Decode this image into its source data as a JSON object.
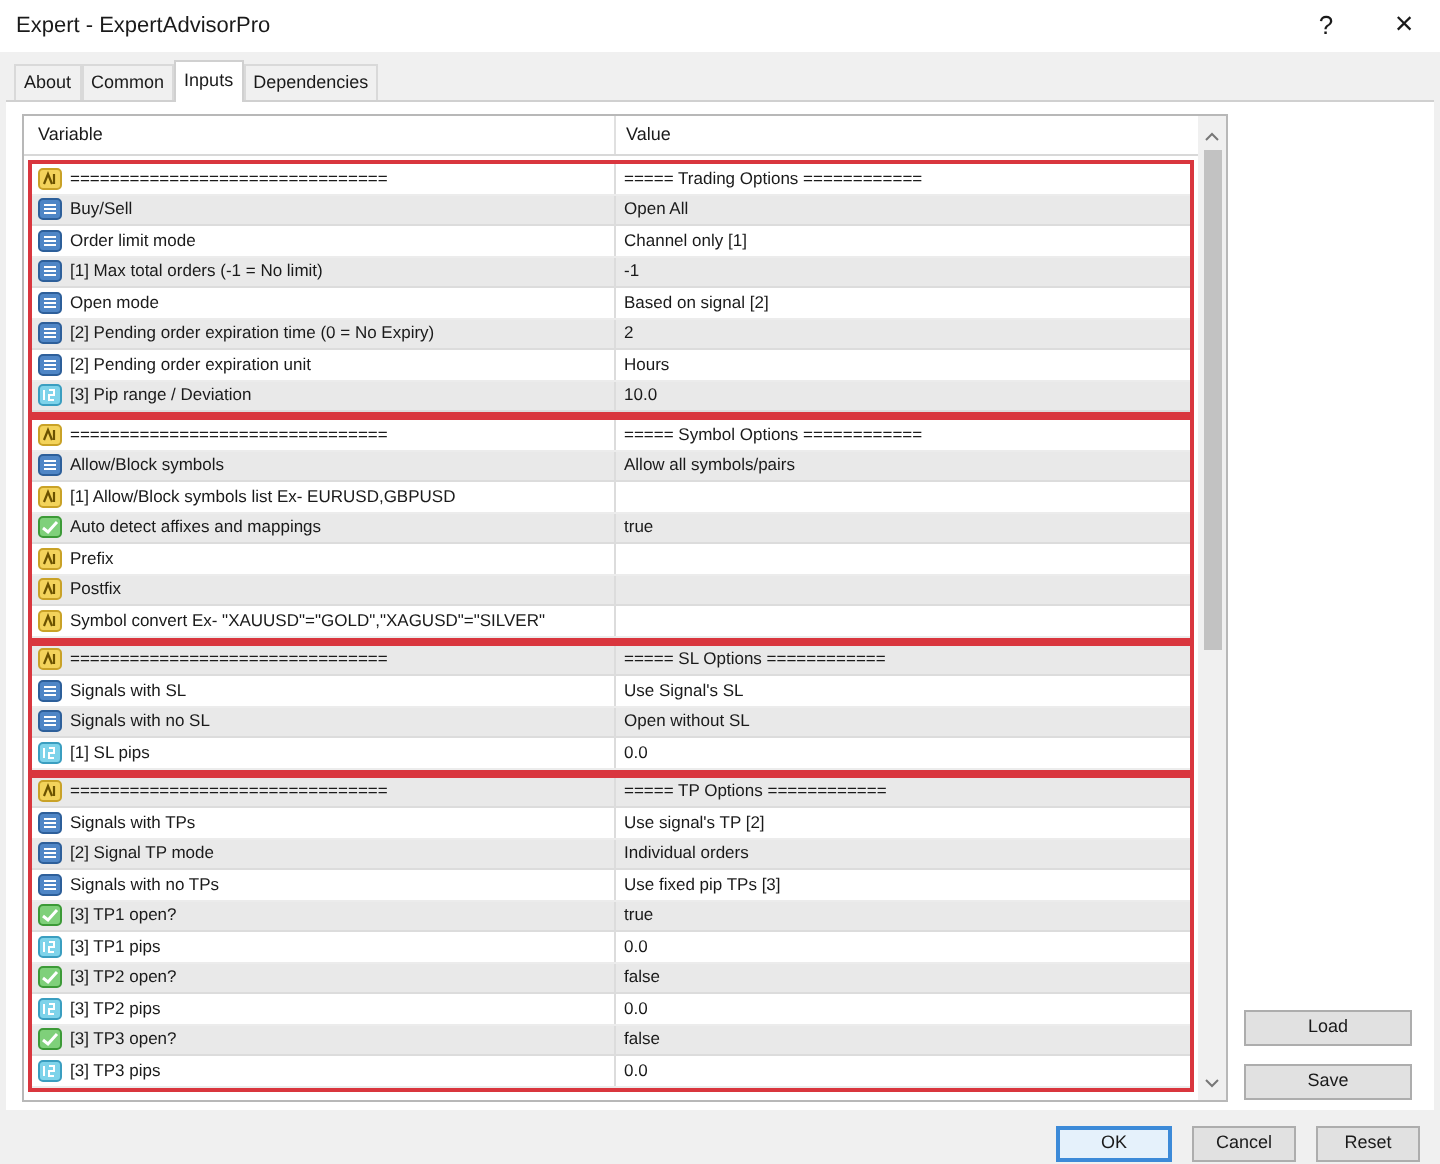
{
  "window": {
    "title": "Expert - ExpertAdvisorPro",
    "help": "?",
    "close": "×"
  },
  "tabs": [
    {
      "label": "About",
      "selected": false
    },
    {
      "label": "Common",
      "selected": false
    },
    {
      "label": "Inputs",
      "selected": true
    },
    {
      "label": "Dependencies",
      "selected": false
    }
  ],
  "table": {
    "columns": [
      "Variable",
      "Value"
    ],
    "groups": [
      {
        "rows": [
          {
            "kind": "string",
            "variable": "================================",
            "value": "===== Trading Options ============"
          },
          {
            "kind": "enum",
            "variable": "Buy/Sell",
            "value": "Open All"
          },
          {
            "kind": "enum",
            "variable": "Order limit mode",
            "value": "Channel only [1]"
          },
          {
            "kind": "enum",
            "variable": "[1] Max total orders (-1 = No limit)",
            "value": "-1"
          },
          {
            "kind": "enum",
            "variable": "Open mode",
            "value": "Based on signal [2]"
          },
          {
            "kind": "enum",
            "variable": "[2] Pending order expiration time (0 = No Expiry)",
            "value": "2"
          },
          {
            "kind": "enum",
            "variable": "[2] Pending order expiration unit",
            "value": "Hours"
          },
          {
            "kind": "number",
            "variable": "[3] Pip range / Deviation",
            "value": "10.0"
          }
        ]
      },
      {
        "rows": [
          {
            "kind": "string",
            "variable": "================================",
            "value": "===== Symbol Options ============"
          },
          {
            "kind": "enum",
            "variable": "Allow/Block symbols",
            "value": "Allow all symbols/pairs"
          },
          {
            "kind": "string",
            "variable": "[1] Allow/Block symbols list Ex- EURUSD,GBPUSD"
          },
          {
            "kind": "bool",
            "variable": "Auto detect affixes and mappings",
            "value": "true"
          },
          {
            "kind": "string",
            "variable": "Prefix"
          },
          {
            "kind": "string",
            "variable": "Postfix"
          },
          {
            "kind": "string",
            "variable": "Symbol convert Ex- \"XAUUSD\"=\"GOLD\",\"XAGUSD\"=\"SILVER\""
          }
        ]
      },
      {
        "rows": [
          {
            "kind": "string",
            "variable": "================================",
            "value": "===== SL Options ============"
          },
          {
            "kind": "enum",
            "variable": "Signals with SL",
            "value": "Use Signal's SL"
          },
          {
            "kind": "enum",
            "variable": "Signals with no SL",
            "value": "Open without SL"
          },
          {
            "kind": "number",
            "variable": "[1] SL pips",
            "value": "0.0"
          }
        ]
      },
      {
        "rows": [
          {
            "kind": "string",
            "variable": "================================",
            "value": "===== TP Options ============"
          },
          {
            "kind": "enum",
            "variable": "Signals with TPs",
            "value": "Use signal's TP [2]"
          },
          {
            "kind": "enum",
            "variable": "[2] Signal TP mode",
            "value": "Individual orders"
          },
          {
            "kind": "enum",
            "variable": "Signals with no TPs",
            "value": "Use fixed pip TPs [3]"
          },
          {
            "kind": "bool",
            "variable": "[3] TP1 open?",
            "value": "true"
          },
          {
            "kind": "number",
            "variable": "[3] TP1 pips",
            "value": "0.0"
          },
          {
            "kind": "bool",
            "variable": "[3] TP2 open?",
            "value": "false"
          },
          {
            "kind": "number",
            "variable": "[3] TP2 pips",
            "value": "0.0"
          },
          {
            "kind": "bool",
            "variable": "[3] TP3 open?",
            "value": "false"
          },
          {
            "kind": "number",
            "variable": "[3] TP3 pips",
            "value": "0.0"
          }
        ]
      }
    ]
  },
  "side_buttons": [
    "Load",
    "Save"
  ],
  "buttons": [
    {
      "label": "OK",
      "default": true
    },
    {
      "label": "Cancel",
      "default": false
    },
    {
      "label": "Reset",
      "default": false
    }
  ]
}
